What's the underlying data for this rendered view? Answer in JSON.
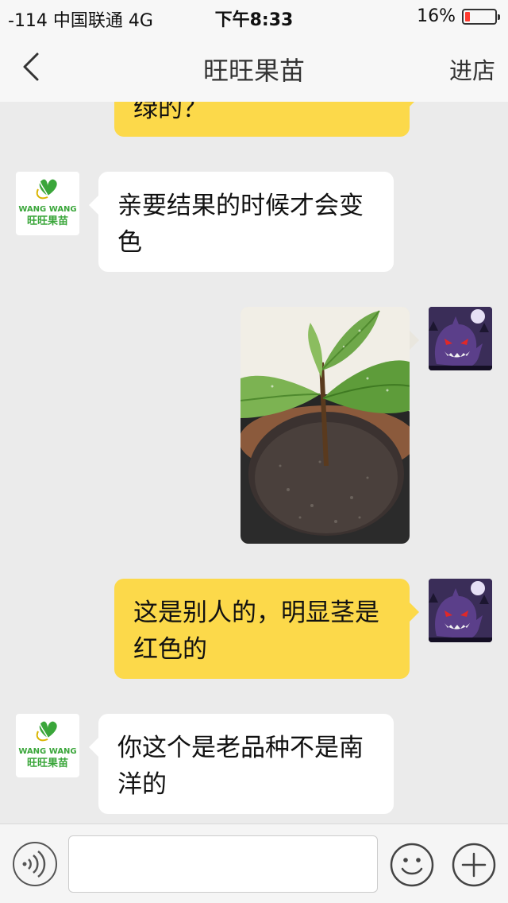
{
  "status_bar": {
    "carrier": "-114 中国联通   4G",
    "time": "下午8:33",
    "battery_percent": "16%",
    "battery_level": 0.16,
    "battery_color": "#ff3b30"
  },
  "nav": {
    "title": "旺旺果苗",
    "shop_label": "进店"
  },
  "shop_avatar": {
    "brand_en": "WANG WANG",
    "brand_cn": "旺旺果苗"
  },
  "messages": [
    {
      "sender": "me",
      "type": "text",
      "text": "绿的？"
    },
    {
      "sender": "shop",
      "type": "text",
      "line1": "亲要结果的时候才会变",
      "line2": "色"
    },
    {
      "sender": "me",
      "type": "image",
      "content": "plant-photo"
    },
    {
      "sender": "me",
      "type": "text",
      "line1": "这是别人的，明显茎是",
      "line2": "红色的"
    },
    {
      "sender": "shop",
      "type": "text",
      "line1": "你这个是老品种不是南",
      "line2": "洋的"
    }
  ],
  "input": {
    "value": "",
    "placeholder": ""
  },
  "colors": {
    "outgoing_bubble": "#fcd94a",
    "incoming_bubble": "#ffffff",
    "brand_green": "#3aa63a"
  }
}
